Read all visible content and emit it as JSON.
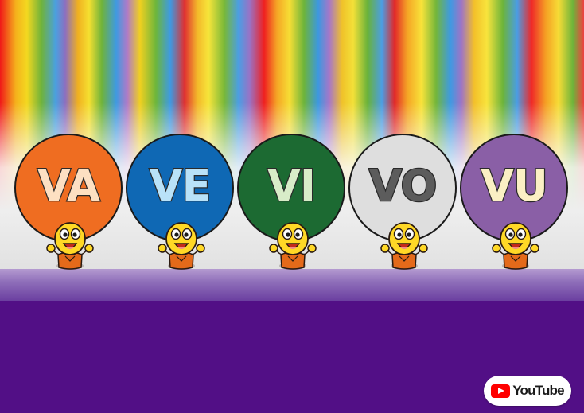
{
  "balloons": [
    {
      "label": "VA",
      "color": "#ef6d21",
      "text_color": "#fde0c2"
    },
    {
      "label": "VE",
      "color": "#0f68b4",
      "text_color": "#b9e2f8"
    },
    {
      "label": "VI",
      "color": "#1c6a32",
      "text_color": "#d8ecc8"
    },
    {
      "label": "VO",
      "color": "#dedede",
      "text_color": "#5c5c5c"
    },
    {
      "label": "VU",
      "color": "#8a5fa6",
      "text_color": "#fbf0c4"
    }
  ],
  "character": {
    "name": "smiling-kid",
    "skin": "#ffd826",
    "shirt": "#e46a1a"
  },
  "stage": {
    "top_color": "#9d7fc4",
    "floor_color": "#520f86"
  },
  "watermark": {
    "label": "YouTube",
    "icon": "play-icon",
    "icon_color": "#ff0000"
  }
}
